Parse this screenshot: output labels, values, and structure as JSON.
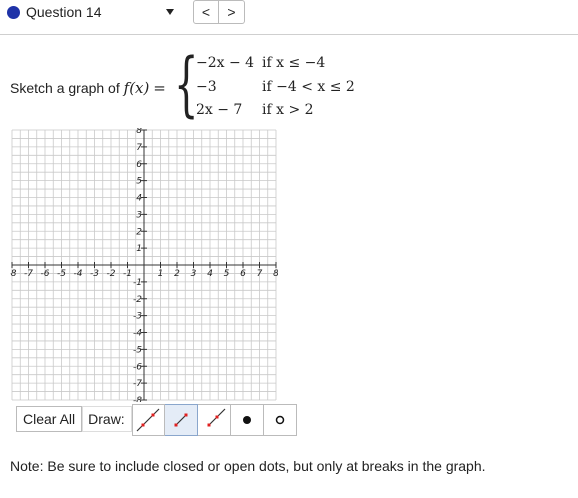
{
  "question_nav": {
    "label": "Question 14",
    "prev_symbol": "<",
    "next_symbol": ">"
  },
  "prompt": {
    "text": "Sketch a graph of",
    "function_name": "f(x)",
    "equals": "="
  },
  "piecewise": [
    {
      "expr": "−2x − 4",
      "cond": "if  x ≤ −4"
    },
    {
      "expr": "−3",
      "cond": "if  −4 < x ≤ 2"
    },
    {
      "expr": "2x − 7",
      "cond": "if  x > 2"
    }
  ],
  "graph": {
    "xmin": -8,
    "xmax": 8,
    "ymin": -8,
    "ymax": 8,
    "minor_step": 0.5,
    "x_tick_labels": [
      "-8",
      "-7",
      "-6",
      "-5",
      "-4",
      "-3",
      "-2",
      "-1",
      "1",
      "2",
      "3",
      "4",
      "5",
      "6",
      "7",
      "8"
    ],
    "y_tick_labels": [
      "8",
      "7",
      "6",
      "5",
      "4",
      "3",
      "2",
      "1",
      "-1",
      "-2",
      "-3",
      "-4",
      "-5",
      "-6",
      "-7",
      "-8"
    ],
    "grid_color": "#c9c9c9",
    "axis_color": "#333333"
  },
  "toolbar": {
    "clear_label": "Clear All",
    "draw_label": "Draw:",
    "tools": [
      {
        "name": "line-tool",
        "icon": "line-icon",
        "active": false
      },
      {
        "name": "segment-tool",
        "icon": "segment-icon",
        "active": true
      },
      {
        "name": "ray-tool",
        "icon": "ray-icon",
        "active": false
      },
      {
        "name": "closed-dot-tool",
        "icon": "closed-dot-icon",
        "active": false
      },
      {
        "name": "open-dot-tool",
        "icon": "open-dot-icon",
        "active": false
      }
    ],
    "accent_color": "#e02020"
  },
  "note": "Note: Be sure to include closed or open dots, but only at breaks in the graph."
}
